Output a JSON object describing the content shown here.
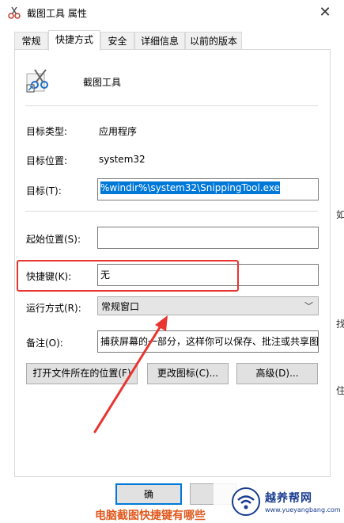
{
  "window": {
    "title": "截图工具 属性"
  },
  "tabs": [
    {
      "label": "常规"
    },
    {
      "label": "快捷方式"
    },
    {
      "label": "安全"
    },
    {
      "label": "详细信息"
    },
    {
      "label": "以前的版本"
    }
  ],
  "app": {
    "name": "截图工具"
  },
  "fields": {
    "target_type_label": "目标类型:",
    "target_type_value": "应用程序",
    "target_location_label": "目标位置:",
    "target_location_value": "system32",
    "target_label": "目标(T):",
    "target_value": "%windir%\\system32\\SnippingTool.exe",
    "start_in_label": "起始位置(S):",
    "start_in_value": "",
    "shortcut_key_label": "快捷键(K):",
    "shortcut_key_value": "无",
    "run_label": "运行方式(R):",
    "run_value": "常规窗口",
    "comment_label": "备注(O):",
    "comment_value": "捕获屏幕的一部分，这样你可以保存、批注或共享图"
  },
  "buttons": {
    "open_location": "打开文件所在的位置(F)",
    "change_icon": "更改图标(C)...",
    "advanced": "高级(D)...",
    "ok": "确"
  },
  "background": {
    "fragment_1": "如",
    "fragment_2": "找",
    "fragment_3": "住",
    "bottom_text": "电脑截图快捷键有哪些"
  },
  "watermark": {
    "title": "越养帮网",
    "url": "www.yueyangbang.com"
  },
  "colors": {
    "accent": "#0078d7",
    "highlight_box": "#e8352f",
    "arrow": "#e8352f",
    "watermark": "#1a3d8f"
  },
  "icons": {
    "title": "scissors-icon",
    "close": "close-icon",
    "app": "snipping-tool-icon",
    "dropdown": "chevron-down-icon"
  }
}
